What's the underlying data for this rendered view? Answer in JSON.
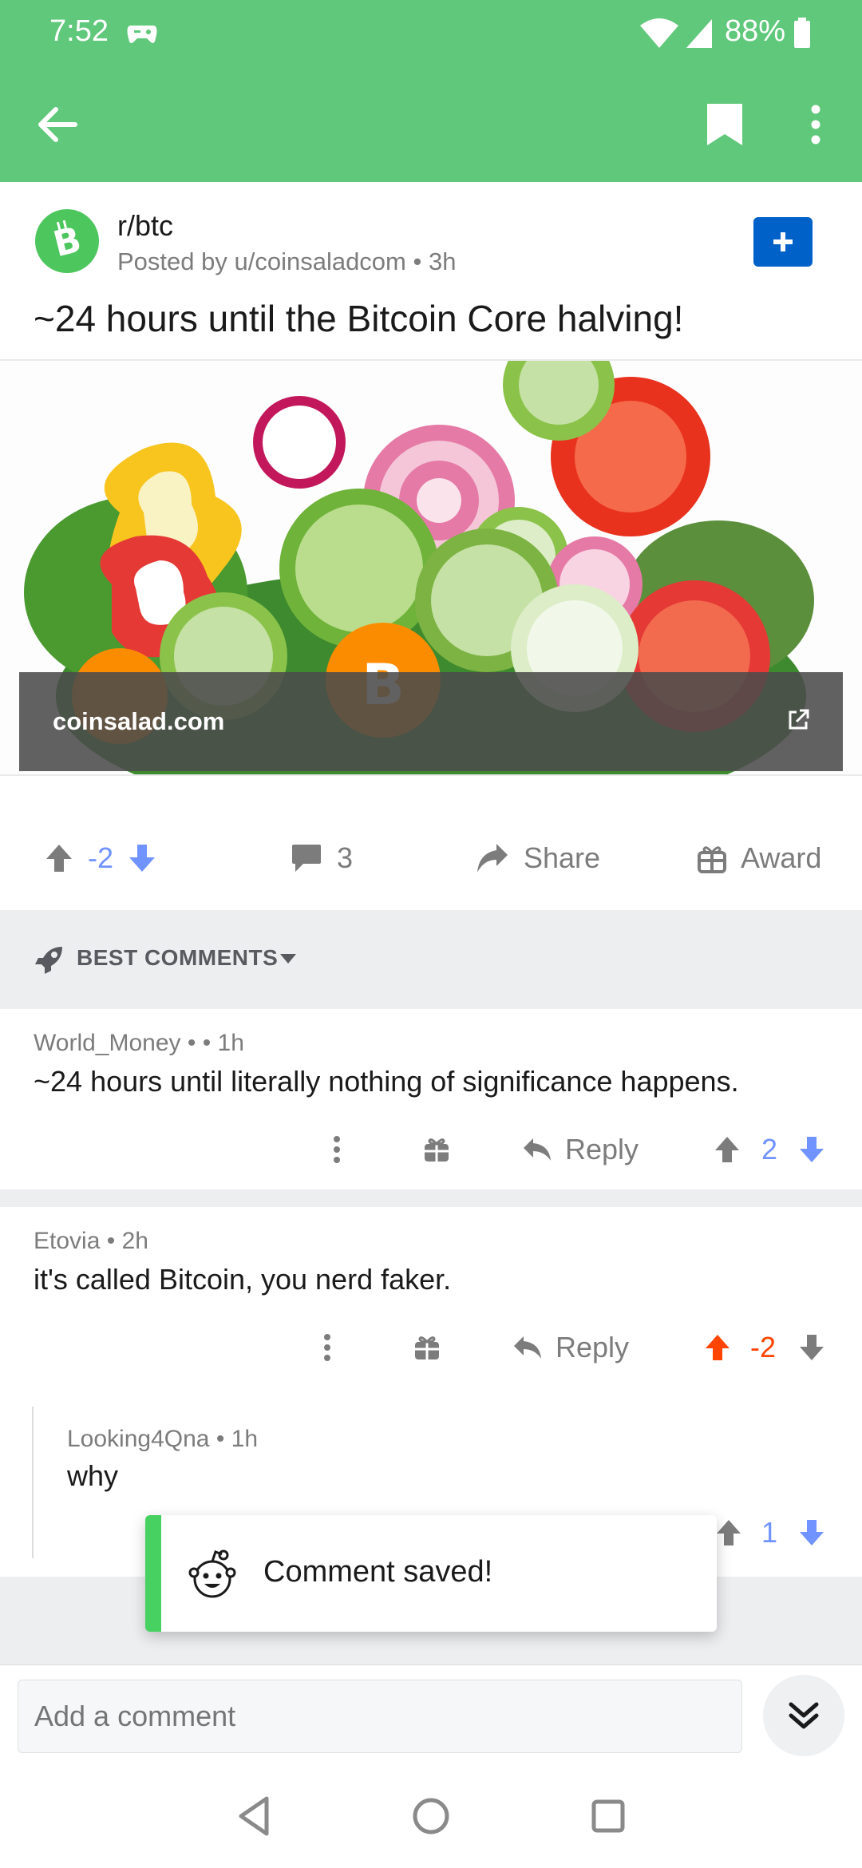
{
  "status_bar": {
    "time": "7:52",
    "battery": "88%"
  },
  "post": {
    "subreddit": "r/btc",
    "posted_by": "Posted by u/coinsaladcom • 3h",
    "title": "~24 hours until the Bitcoin Core halving!",
    "link_domain": "coinsalad.com",
    "score": "-2",
    "comment_count": "3",
    "share_label": "Share",
    "award_label": "Award"
  },
  "sort": {
    "label": "BEST COMMENTS"
  },
  "comments": [
    {
      "author": "World_Money",
      "meta_sep": " •  • 1h",
      "body": "~24 hours until literally nothing of significance happens.",
      "reply_label": "Reply",
      "score": "2"
    },
    {
      "author": "Etovia",
      "meta_sep": " • 2h",
      "body": "it's called Bitcoin, you nerd faker.",
      "reply_label": "Reply",
      "score": "-2"
    },
    {
      "author": "Looking4Qna",
      "meta_sep": " • 1h",
      "body": "why",
      "score": "1"
    }
  ],
  "toast": {
    "text": "Comment saved!"
  },
  "composer": {
    "placeholder": "Add a comment"
  },
  "colors": {
    "brand_green": "#5fc87a",
    "upvote_orange": "#ff4500",
    "downvote_blue": "#7193ff",
    "join_blue": "#0061c9"
  }
}
